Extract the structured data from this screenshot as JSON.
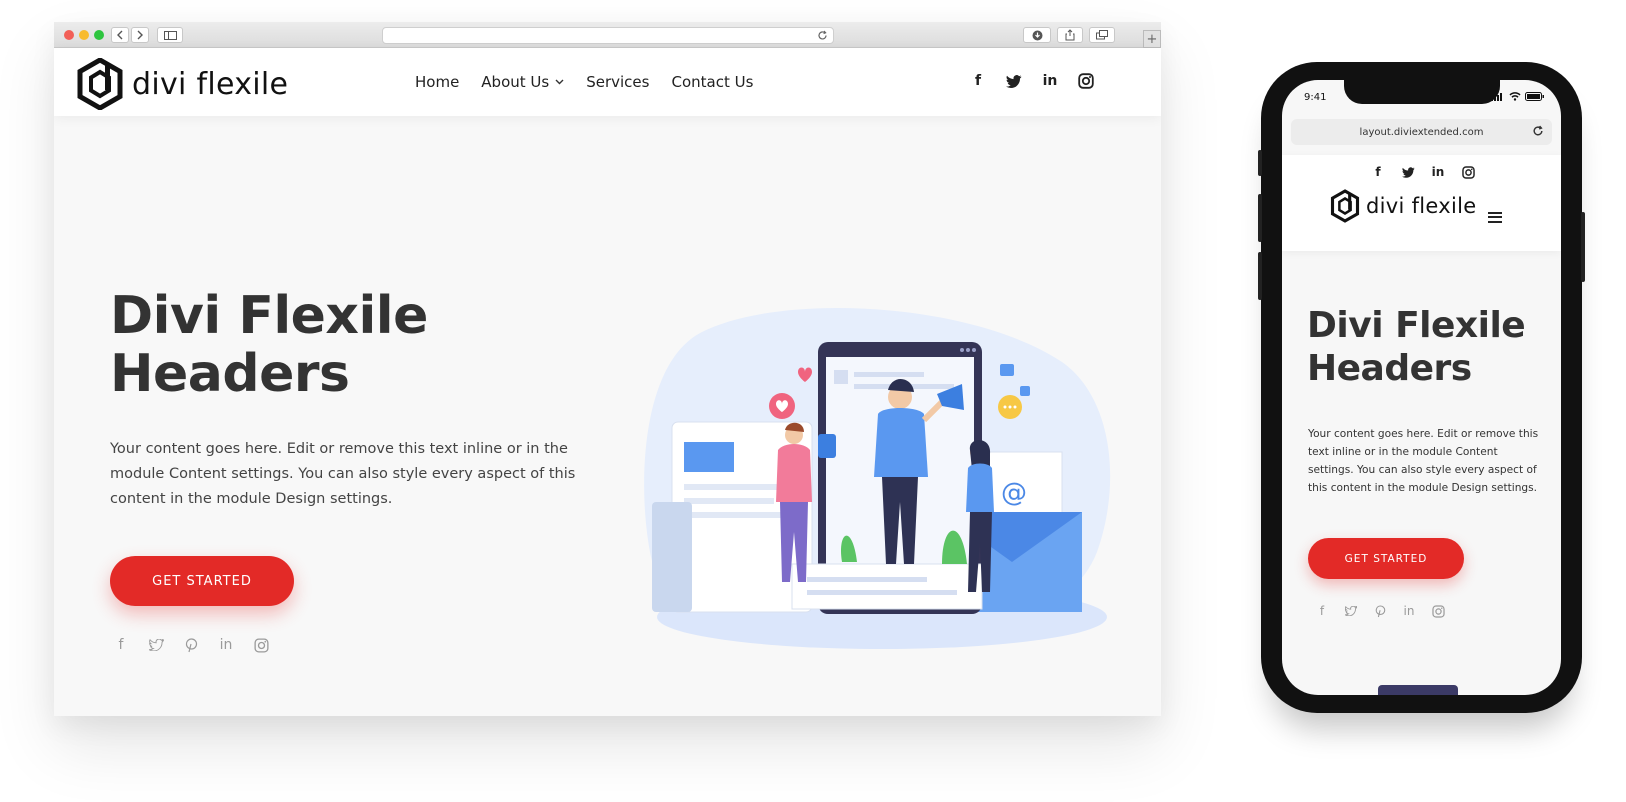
{
  "desktop": {
    "chrome": {
      "nav_back_icon": "chevron-left-icon",
      "nav_forward_icon": "chevron-right-icon",
      "sidebar_icon": "sidebar-icon",
      "reload_icon": "reload-icon",
      "download_icon": "download-icon",
      "share_icon": "share-icon",
      "tabs_icon": "tabs-icon",
      "new_tab": "+"
    },
    "header": {
      "logo_text": "divi flexile",
      "nav": [
        {
          "label": "Home"
        },
        {
          "label": "About Us",
          "has_dropdown": true
        },
        {
          "label": "Services"
        },
        {
          "label": "Contact Us"
        }
      ],
      "social": [
        "facebook-icon",
        "twitter-icon",
        "linkedin-icon",
        "instagram-icon"
      ]
    },
    "hero": {
      "title_line1": "Divi Flexile",
      "title_line2": "Headers",
      "text": "Your content goes here. Edit or remove this text inline or in the module Content settings. You can also style every aspect of this content in the module Design settings.",
      "cta_label": "GET STARTED",
      "social": [
        "facebook-icon",
        "twitter-icon",
        "pinterest-icon",
        "linkedin-icon",
        "instagram-icon"
      ]
    }
  },
  "mobile": {
    "time": "9:41",
    "url": "layout.diviextended.com",
    "header": {
      "logo_text": "divi flexile",
      "social": [
        "facebook-icon",
        "twitter-icon",
        "linkedin-icon",
        "instagram-icon"
      ],
      "menu_icon": "hamburger-menu-icon"
    },
    "hero": {
      "title_line1": "Divi Flexile",
      "title_line2": "Headers",
      "text": "Your content goes here. Edit or remove this text inline or in the module Content settings. You can also style every aspect of this content in the module Design settings.",
      "cta_label": "GET STARTED",
      "social": [
        "facebook-icon",
        "twitter-icon",
        "pinterest-icon",
        "linkedin-icon",
        "instagram-icon"
      ]
    }
  },
  "colors": {
    "accent": "#e32a27",
    "heading": "#333333",
    "background": "#f8f8f8"
  }
}
